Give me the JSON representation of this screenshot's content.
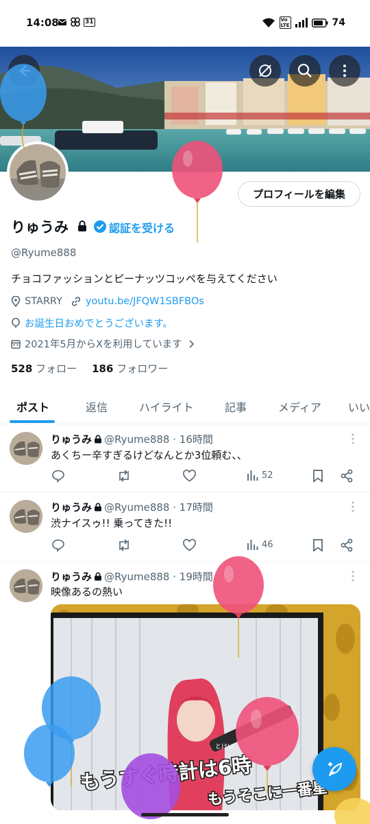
{
  "status_bar": {
    "time": "14:08",
    "battery": "74",
    "calendar_day": "31",
    "network": "Vo LTE"
  },
  "profile": {
    "display_name": "りゅうみ",
    "verify_label": "認証を受ける",
    "handle": "@Ryume888",
    "bio": "チョコファッションとピーナッツコッペを与えてください",
    "location": "STARRY",
    "website": "youtu.be/JFQW1SBFBOs",
    "birthday": "お誕生日おめでとうございます。",
    "joined": "2021年5月からXを利用しています",
    "following_count": "528",
    "following_label": "フォロー",
    "followers_count": "186",
    "followers_label": "フォロワー",
    "edit_button": "プロフィールを編集"
  },
  "tabs": [
    {
      "label": "ポスト",
      "active": true
    },
    {
      "label": "返信"
    },
    {
      "label": "ハイライト"
    },
    {
      "label": "記事"
    },
    {
      "label": "メディア"
    },
    {
      "label": "いい"
    }
  ],
  "posts": [
    {
      "name": "りゅうみ",
      "meta": "@Ryume888 · 16時間",
      "text": "あくちー辛すぎるけどなんとか3位頼む、、",
      "views": "52"
    },
    {
      "name": "りゅうみ",
      "meta": "@Ryume888 · 17時間",
      "text": "渋ナイスゥ!! 乗ってきた!!",
      "views": "46"
    },
    {
      "name": "りゅうみ",
      "meta": "@Ryume888 · 19時間",
      "text": "映像あるの熱い"
    }
  ],
  "media": {
    "subtitle": "もうすぐ時計は6時",
    "subtitle_right": "もうそこに一番星",
    "furigana": "とけい"
  },
  "colors": {
    "accent": "#1d9bf0",
    "text": "#0f1419",
    "muted": "#536471",
    "balloon_pink": "#f0517a",
    "balloon_blue": "#3a9cf0",
    "balloon_purple": "#a54ee0"
  },
  "icons": [
    "mail-icon",
    "pinwheel-icon",
    "calendar-icon",
    "wifi-icon",
    "signal-icon",
    "battery-icon",
    "back-icon",
    "incognito-icon",
    "search-icon",
    "more-icon",
    "lock-icon",
    "verified-icon",
    "location-icon",
    "link-icon",
    "balloon-icon",
    "calendar-joined-icon",
    "reply-icon",
    "repost-icon",
    "like-icon",
    "views-icon",
    "bookmark-icon",
    "share-icon",
    "compose-icon"
  ]
}
